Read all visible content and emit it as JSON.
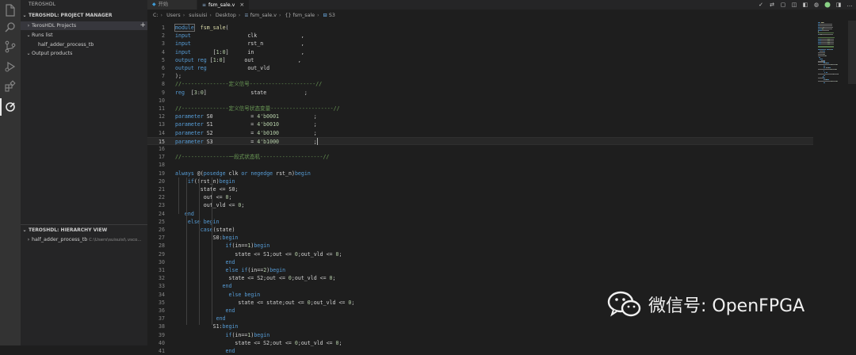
{
  "sidebar": {
    "title": "TEROSHDL",
    "project_manager": {
      "title": "TEROSHDL: PROJECT MANAGER",
      "items": [
        {
          "label": "TerosHDL Projects",
          "arrow": "›"
        },
        {
          "label": "Runs list",
          "arrow": "⌄"
        },
        {
          "label": "half_adder_process_tb",
          "arrow": ""
        },
        {
          "label": "Output products",
          "arrow": "⌄"
        }
      ],
      "add_label": "+"
    },
    "hierarchy": {
      "title": "TEROSHDL: HIERARCHY VIEW",
      "item_label": "half_adder_process_tb",
      "item_path": "C:\\Users\\suisuisi\\.vsco..."
    }
  },
  "tabs": [
    {
      "label": "开始",
      "icon": "vscode-icon"
    },
    {
      "label": "fsm_sale.v",
      "icon": "file-icon",
      "close": "×"
    }
  ],
  "breadcrumb": [
    "C:",
    "Users",
    "suisuisi",
    "Desktop",
    "fsm_sale.v",
    "{} fsm_sale",
    "S3"
  ],
  "code_lines": [
    {
      "n": "1",
      "t": [
        [
          "kw",
          "module"
        ],
        [
          "",
          "  "
        ],
        [
          "fn",
          "fsm_sale"
        ],
        [
          "",
          "("
        ]
      ]
    },
    {
      "n": "2",
      "t": [
        [
          "kw",
          "input"
        ],
        [
          "",
          "                  clk              ,"
        ]
      ]
    },
    {
      "n": "3",
      "t": [
        [
          "kw",
          "input"
        ],
        [
          "",
          "                  rst_n            ,"
        ]
      ]
    },
    {
      "n": "4",
      "t": [
        [
          "kw",
          "input"
        ],
        [
          "",
          "       ["
        ],
        [
          "num",
          "1"
        ],
        [
          "",
          ":"
        ],
        [
          "num",
          "0"
        ],
        [
          "",
          "]      in               ,"
        ]
      ]
    },
    {
      "n": "5",
      "t": [
        [
          "kw",
          "output"
        ],
        [
          "",
          " "
        ],
        [
          "kw",
          "reg"
        ],
        [
          "",
          " ["
        ],
        [
          "num",
          "1"
        ],
        [
          "",
          ":"
        ],
        [
          "num",
          "0"
        ],
        [
          "",
          "]      out              ,"
        ]
      ]
    },
    {
      "n": "6",
      "t": [
        [
          "kw",
          "output"
        ],
        [
          "",
          " "
        ],
        [
          "kw",
          "reg"
        ],
        [
          "",
          "             out_vld"
        ]
      ]
    },
    {
      "n": "7",
      "t": [
        [
          "",
          ");"
        ]
      ]
    },
    {
      "n": "8",
      "t": [
        [
          "cm",
          "//---------------定义信号---------------------//"
        ]
      ]
    },
    {
      "n": "9",
      "t": [
        [
          "kw",
          "reg"
        ],
        [
          "",
          "  ["
        ],
        [
          "num",
          "3"
        ],
        [
          "",
          ":"
        ],
        [
          "num",
          "0"
        ],
        [
          "",
          "]              state            ;"
        ]
      ]
    },
    {
      "n": "10",
      "t": [
        [
          "",
          ""
        ]
      ]
    },
    {
      "n": "11",
      "t": [
        [
          "cm",
          "//---------------定义信号状态变量--------------------//"
        ]
      ]
    },
    {
      "n": "12",
      "t": [
        [
          "kw",
          "parameter"
        ],
        [
          "",
          " S0            = "
        ],
        [
          "num",
          "4'b0001"
        ],
        [
          "",
          "           ;"
        ]
      ]
    },
    {
      "n": "13",
      "t": [
        [
          "kw",
          "parameter"
        ],
        [
          "",
          " S1            = "
        ],
        [
          "num",
          "4'b0010"
        ],
        [
          "",
          "           ;"
        ]
      ]
    },
    {
      "n": "14",
      "t": [
        [
          "kw",
          "parameter"
        ],
        [
          "",
          " S2            = "
        ],
        [
          "num",
          "4'b0100"
        ],
        [
          "",
          "           ;"
        ]
      ]
    },
    {
      "n": "15",
      "t": [
        [
          "kw",
          "parameter"
        ],
        [
          "",
          " S3            = "
        ],
        [
          "num",
          "4'b1000"
        ],
        [
          "",
          "           ;"
        ]
      ]
    },
    {
      "n": "16",
      "t": [
        [
          "",
          ""
        ]
      ]
    },
    {
      "n": "17",
      "t": [
        [
          "cm",
          "//---------------一段式状态机--------------------//"
        ]
      ]
    },
    {
      "n": "18",
      "t": [
        [
          "",
          ""
        ]
      ]
    },
    {
      "n": "19",
      "t": [
        [
          "kw",
          "always"
        ],
        [
          "",
          " @("
        ],
        [
          "kw",
          "posedge"
        ],
        [
          "",
          " clk "
        ],
        [
          "kw",
          "or"
        ],
        [
          "",
          " "
        ],
        [
          "kw",
          "negedge"
        ],
        [
          "",
          " rst_n)"
        ],
        [
          "kw",
          "begin"
        ]
      ]
    },
    {
      "n": "20",
      "t": [
        [
          "",
          "    "
        ],
        [
          "kw",
          "if"
        ],
        [
          "",
          "(!rst_n)"
        ],
        [
          "kw",
          "begin"
        ]
      ]
    },
    {
      "n": "21",
      "t": [
        [
          "",
          "        state <= S0;"
        ]
      ]
    },
    {
      "n": "22",
      "t": [
        [
          "",
          "         out <= "
        ],
        [
          "num",
          "0"
        ],
        [
          "",
          ";"
        ]
      ]
    },
    {
      "n": "23",
      "t": [
        [
          "",
          "         out_vld <= "
        ],
        [
          "num",
          "0"
        ],
        [
          "",
          ";"
        ]
      ]
    },
    {
      "n": "24",
      "t": [
        [
          "",
          "   "
        ],
        [
          "kw",
          "end"
        ]
      ]
    },
    {
      "n": "25",
      "t": [
        [
          "",
          "    "
        ],
        [
          "kw",
          "else"
        ],
        [
          "",
          " "
        ],
        [
          "kw",
          "begin"
        ]
      ]
    },
    {
      "n": "26",
      "t": [
        [
          "",
          "        "
        ],
        [
          "kw",
          "case"
        ],
        [
          "",
          "(state)"
        ]
      ]
    },
    {
      "n": "27",
      "t": [
        [
          "",
          "            S0:"
        ],
        [
          "kw",
          "begin"
        ]
      ]
    },
    {
      "n": "28",
      "t": [
        [
          "",
          "                "
        ],
        [
          "kw",
          "if"
        ],
        [
          "",
          "(in=="
        ],
        [
          "num",
          "1"
        ],
        [
          "",
          ")"
        ],
        [
          "kw",
          "begin"
        ]
      ]
    },
    {
      "n": "29",
      "t": [
        [
          "",
          "                   state <= S1;out <= "
        ],
        [
          "num",
          "0"
        ],
        [
          "",
          ";out_vld <= "
        ],
        [
          "num",
          "0"
        ],
        [
          "",
          ";"
        ]
      ]
    },
    {
      "n": "30",
      "t": [
        [
          "",
          "                "
        ],
        [
          "kw",
          "end"
        ]
      ]
    },
    {
      "n": "31",
      "t": [
        [
          "",
          "                "
        ],
        [
          "kw",
          "else"
        ],
        [
          "",
          " "
        ],
        [
          "kw",
          "if"
        ],
        [
          "",
          "(in=="
        ],
        [
          "num",
          "2"
        ],
        [
          "",
          ")"
        ],
        [
          "kw",
          "begin"
        ]
      ]
    },
    {
      "n": "32",
      "t": [
        [
          "",
          "                 state <= S2;out <= "
        ],
        [
          "num",
          "0"
        ],
        [
          "",
          ";out_vld <= "
        ],
        [
          "num",
          "0"
        ],
        [
          "",
          ";"
        ]
      ]
    },
    {
      "n": "33",
      "t": [
        [
          "",
          "               "
        ],
        [
          "kw",
          "end"
        ]
      ]
    },
    {
      "n": "34",
      "t": [
        [
          "",
          "                 "
        ],
        [
          "kw",
          "else"
        ],
        [
          "",
          " "
        ],
        [
          "kw",
          "begin"
        ]
      ]
    },
    {
      "n": "35",
      "t": [
        [
          "",
          "                    state <= state;out <= "
        ],
        [
          "num",
          "0"
        ],
        [
          "",
          ";out_vld <= "
        ],
        [
          "num",
          "0"
        ],
        [
          "",
          ";"
        ]
      ]
    },
    {
      "n": "36",
      "t": [
        [
          "",
          "                "
        ],
        [
          "kw",
          "end"
        ]
      ]
    },
    {
      "n": "37",
      "t": [
        [
          "",
          "             "
        ],
        [
          "kw",
          "end"
        ]
      ]
    },
    {
      "n": "38",
      "t": [
        [
          "",
          "            S1:"
        ],
        [
          "kw",
          "begin"
        ]
      ]
    },
    {
      "n": "39",
      "t": [
        [
          "",
          "                "
        ],
        [
          "kw",
          "if"
        ],
        [
          "",
          "(in=="
        ],
        [
          "num",
          "1"
        ],
        [
          "",
          ")"
        ],
        [
          "kw",
          "begin"
        ]
      ]
    },
    {
      "n": "40",
      "t": [
        [
          "",
          "                   state <= S2;out <= "
        ],
        [
          "num",
          "0"
        ],
        [
          "",
          ";out_vld <= "
        ],
        [
          "num",
          "0"
        ],
        [
          "",
          ";"
        ]
      ]
    },
    {
      "n": "41",
      "t": [
        [
          "",
          "                "
        ],
        [
          "kw",
          "end"
        ]
      ]
    }
  ],
  "current_line": "15",
  "watermark": {
    "text": "微信号: OpenFPGA"
  },
  "colors": {
    "keyword": "#569cd6",
    "comment": "#6a9955",
    "number": "#b5cea8",
    "function": "#dcdcaa"
  },
  "activity_icons": [
    "explorer-icon",
    "search-icon",
    "source-control-icon",
    "run-debug-icon",
    "extensions-icon",
    "teroshdl-icon"
  ]
}
